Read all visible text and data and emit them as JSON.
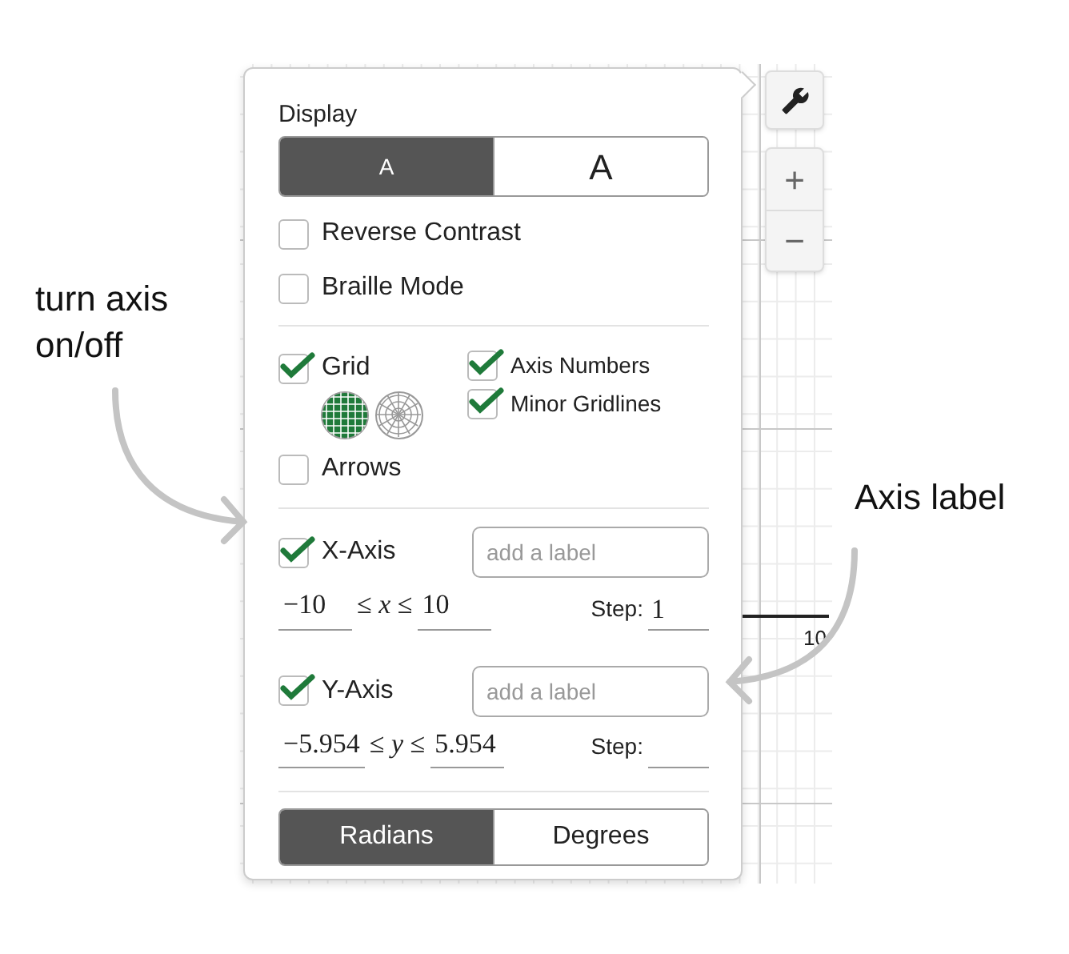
{
  "display": {
    "label": "Display",
    "text_sizes": [
      {
        "label": "A",
        "selected": true
      },
      {
        "label": "A",
        "selected": false
      }
    ]
  },
  "options": [
    {
      "label": "Reverse Contrast",
      "checked": false
    },
    {
      "label": "Braille Mode",
      "checked": false
    }
  ],
  "grid": {
    "label": "Grid",
    "checked": true,
    "grid_types": [
      {
        "kind": "cartesian",
        "selected": true
      },
      {
        "kind": "polar",
        "selected": false
      }
    ]
  },
  "grid_options": [
    {
      "label": "Axis Numbers",
      "checked": true
    },
    {
      "label": "Minor Gridlines",
      "checked": true
    }
  ],
  "arrows": {
    "label": "Arrows",
    "checked": false
  },
  "axes": [
    {
      "label": "X-Axis",
      "checked": true,
      "placeholder": "add a label",
      "min": "−10",
      "relation": "≤ *x* ≤",
      "max": "10",
      "step_label": "Step:",
      "step": "1"
    },
    {
      "label": "Y-Axis",
      "checked": true,
      "placeholder": "add a label",
      "min": "−5.954",
      "relation": "≤ *y* ≤",
      "max": "5.954",
      "step_label": "Step:"
    }
  ],
  "angle_units": [
    {
      "label": "Radians",
      "selected": true
    },
    {
      "label": "Degrees",
      "selected": false
    }
  ],
  "zoom_buttons": [
    "+",
    "−"
  ],
  "graph": {
    "tick_label": "10"
  },
  "annotations": [
    {
      "text": "turn axis on/off"
    },
    {
      "text": "Axis label"
    }
  ]
}
